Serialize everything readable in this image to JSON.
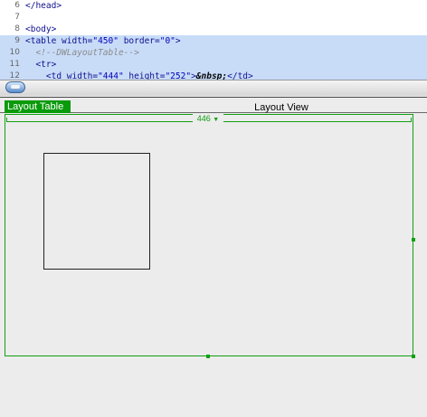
{
  "code_view": {
    "lines": [
      {
        "number": "6",
        "parts": [
          {
            "t": "</head>",
            "k": "tag"
          }
        ],
        "selected": false
      },
      {
        "number": "7",
        "parts": [],
        "selected": false
      },
      {
        "number": "8",
        "parts": [
          {
            "t": "<body>",
            "k": "tag"
          }
        ],
        "selected": false
      },
      {
        "number": "9",
        "parts": [
          {
            "t": "<table width=",
            "k": "tag"
          },
          {
            "t": "\"450\"",
            "k": "str"
          },
          {
            "t": " border=",
            "k": "tag"
          },
          {
            "t": "\"0\"",
            "k": "str"
          },
          {
            "t": ">",
            "k": "tag"
          }
        ],
        "selected": true
      },
      {
        "number": "10",
        "parts": [
          {
            "t": "  <!--DWLayoutTable-->",
            "k": "comment"
          }
        ],
        "selected": true
      },
      {
        "number": "11",
        "parts": [
          {
            "t": "  <tr>",
            "k": "tag"
          }
        ],
        "selected": true
      },
      {
        "number": "12",
        "parts": [
          {
            "t": "    <td width=",
            "k": "tag"
          },
          {
            "t": "\"444\"",
            "k": "str"
          },
          {
            "t": " height=",
            "k": "tag"
          },
          {
            "t": "\"252\"",
            "k": "str"
          },
          {
            "t": ">",
            "k": "tag"
          },
          {
            "t": "&nbsp;",
            "k": "entity"
          },
          {
            "t": "</td>",
            "k": "tag"
          }
        ],
        "selected": true
      }
    ]
  },
  "design_view": {
    "layout_table_label": "Layout Table",
    "view_title": "Layout View",
    "table_width_label": "446",
    "table_width_arrow": "▼"
  },
  "colors": {
    "layout_green": "#12a012",
    "selection": "#c8dcf8"
  }
}
